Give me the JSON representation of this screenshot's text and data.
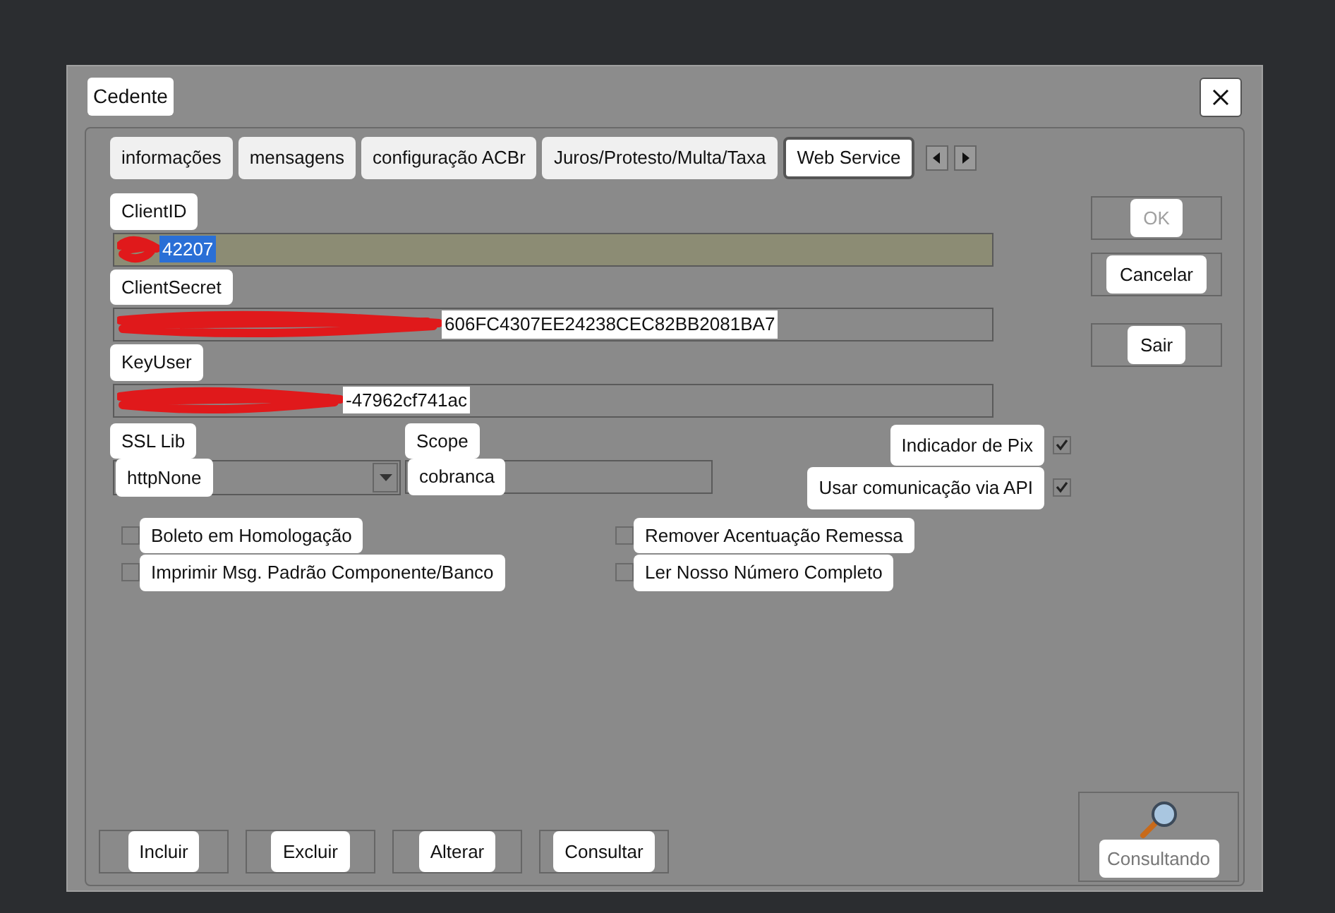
{
  "window": {
    "title": "Cedente"
  },
  "tabs": [
    {
      "label": "informações",
      "selected": false
    },
    {
      "label": "mensagens",
      "selected": false
    },
    {
      "label": "configuração ACBr",
      "selected": false
    },
    {
      "label": "Juros/Protesto/Multa/Taxa",
      "selected": false
    },
    {
      "label": "Web Service",
      "selected": true
    }
  ],
  "fields": [
    {
      "label": "ClientID",
      "value": "42207",
      "focused": true,
      "redacted": true
    },
    {
      "label": "ClientSecret",
      "value": "606FC4307EE24238CEC82BB2081BA7",
      "focused": false,
      "redacted": true
    },
    {
      "label": "KeyUser",
      "value": "-47962cf741ac",
      "focused": false,
      "redacted": true
    }
  ],
  "ssl_lib": {
    "label": "SSL Lib",
    "value": "httpNone"
  },
  "scope": {
    "label": "Scope",
    "value": "cobranca"
  },
  "right_checks": [
    {
      "label": "Indicador de Pix",
      "checked": true
    },
    {
      "label": "Usar comunicação via API",
      "checked": true
    }
  ],
  "left_options": [
    {
      "label": "Boleto em Homologação",
      "checked": false
    },
    {
      "label": "Imprimir Msg. Padrão Componente/Banco",
      "checked": false
    }
  ],
  "right_options": [
    {
      "label": "Remover Acentuação Remessa",
      "checked": false
    },
    {
      "label": "Ler Nosso Número Completo",
      "checked": false
    }
  ],
  "side_buttons": [
    {
      "label": "OK",
      "disabled": true
    },
    {
      "label": "Cancelar",
      "disabled": false
    },
    {
      "label": "Sair",
      "disabled": false
    }
  ],
  "bottom_buttons": [
    "Incluir",
    "Excluir",
    "Alterar",
    "Consultar"
  ],
  "status": {
    "label": "Consultando"
  }
}
